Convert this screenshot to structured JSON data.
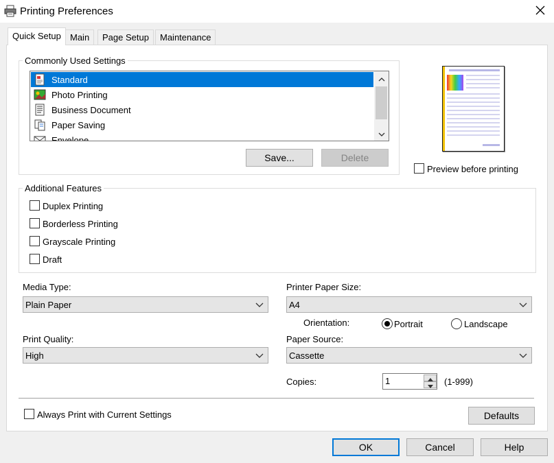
{
  "window": {
    "title": "Printing Preferences"
  },
  "tabs": [
    {
      "label": "Quick Setup",
      "active": true
    },
    {
      "label": "Main",
      "active": false
    },
    {
      "label": "Page Setup",
      "active": false
    },
    {
      "label": "Maintenance",
      "active": false
    }
  ],
  "commonly_used": {
    "title": "Commonly Used Settings",
    "items": [
      {
        "label": "Standard",
        "icon": "standard-icon",
        "selected": true
      },
      {
        "label": "Photo Printing",
        "icon": "photo-icon",
        "selected": false
      },
      {
        "label": "Business Document",
        "icon": "document-icon",
        "selected": false
      },
      {
        "label": "Paper Saving",
        "icon": "paper-saving-icon",
        "selected": false
      },
      {
        "label": "Envelope",
        "icon": "envelope-icon",
        "selected": false
      }
    ],
    "save_label": "Save...",
    "delete_label": "Delete"
  },
  "preview": {
    "checkbox_label": "Preview before printing",
    "checked": false
  },
  "additional_features": {
    "title": "Additional Features",
    "items": [
      {
        "label": "Duplex Printing",
        "checked": false
      },
      {
        "label": "Borderless Printing",
        "checked": false
      },
      {
        "label": "Grayscale Printing",
        "checked": false
      },
      {
        "label": "Draft",
        "checked": false
      }
    ]
  },
  "media_type": {
    "label": "Media Type:",
    "value": "Plain Paper"
  },
  "printer_paper_size": {
    "label": "Printer Paper Size:",
    "value": "A4"
  },
  "orientation": {
    "label": "Orientation:",
    "portrait": "Portrait",
    "landscape": "Landscape",
    "selected": "Portrait"
  },
  "print_quality": {
    "label": "Print Quality:",
    "value": "High"
  },
  "paper_source": {
    "label": "Paper Source:",
    "value": "Cassette"
  },
  "copies": {
    "label": "Copies:",
    "value": "1",
    "range": "(1-999)"
  },
  "always_print": {
    "label": "Always Print with Current Settings",
    "checked": false
  },
  "defaults_label": "Defaults",
  "footer": {
    "ok": "OK",
    "cancel": "Cancel",
    "help": "Help"
  },
  "colors": {
    "selection": "#0078d7",
    "accent": "#0078d7"
  }
}
